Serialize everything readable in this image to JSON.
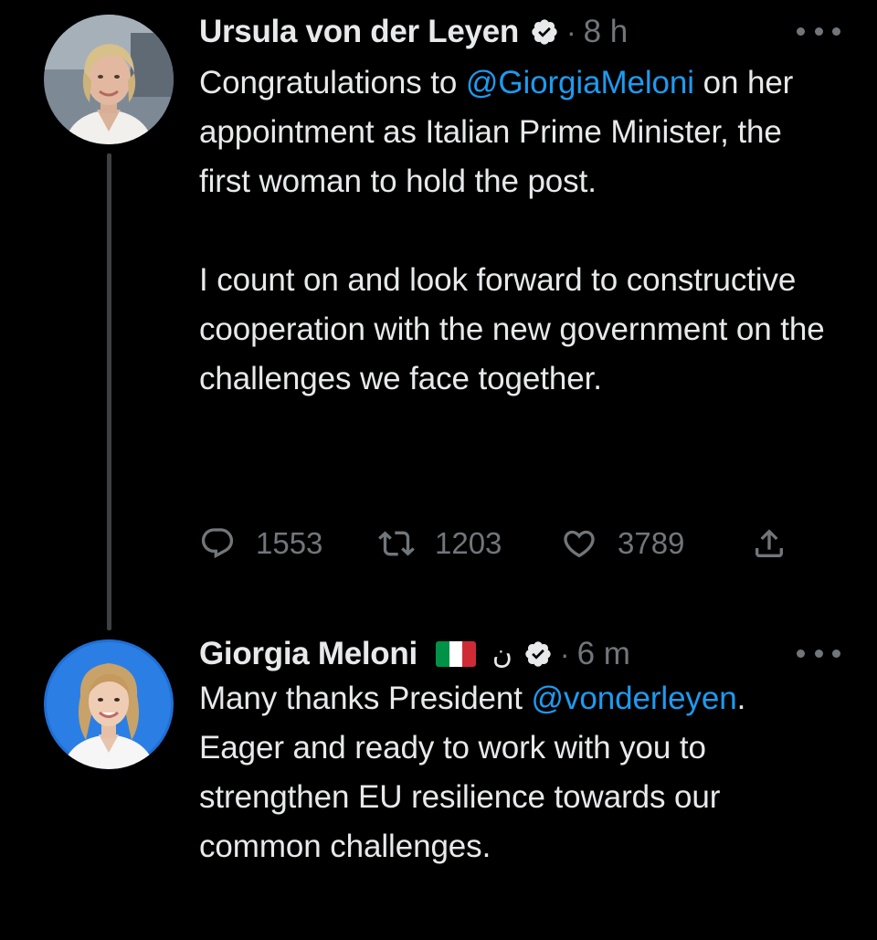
{
  "colors": {
    "background": "#000000",
    "text_primary": "#e7e9ea",
    "text_secondary": "#71767b",
    "link": "#1d9bf0",
    "verified": "#e7e9ea",
    "thread_line": "#3e4144"
  },
  "tweets": [
    {
      "author_name": "Ursula von der Leyen",
      "verified": true,
      "separator": "·",
      "time": "8 h",
      "more_icon": "more-horizontal-icon",
      "body": {
        "p1_before": "Congratulations to ",
        "p1_mention": "@GiorgiaMeloni",
        "p1_after": " on her appointment as Italian Prime Minister, the first woman to hold the post.",
        "p2": "I count on and look forward to constructive cooperation with the new government on the challenges we face together."
      },
      "actions": {
        "reply_icon": "reply-icon",
        "reply_count": "1553",
        "retweet_icon": "retweet-icon",
        "retweet_count": "1203",
        "like_icon": "heart-icon",
        "like_count": "3789",
        "share_icon": "share-icon"
      }
    },
    {
      "author_name": "Giorgia Meloni",
      "flag": "italy-flag",
      "name_suffix": "ن",
      "verified": true,
      "separator": "·",
      "time": "6 m",
      "more_icon": "more-horizontal-icon",
      "body": {
        "p1_before": "Many thanks President ",
        "p1_mention": "@vonderleyen",
        "p1_after": ". Eager and ready to work with you to strengthen EU resilience towards our common challenges."
      }
    }
  ]
}
